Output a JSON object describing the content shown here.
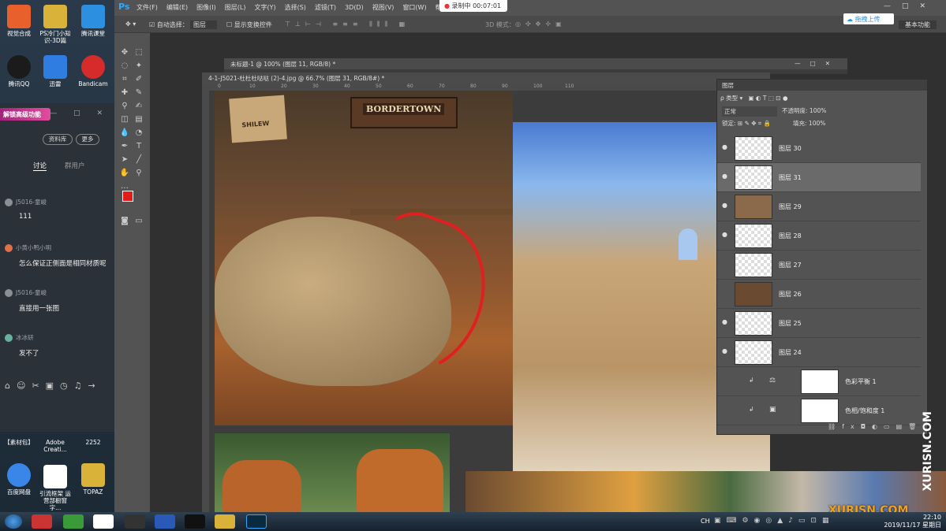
{
  "desktop": {
    "icons_top": [
      {
        "label": "视觉合成",
        "color": "#e8612c"
      },
      {
        "label": "PS冷门小知识-3D篇",
        "color": "#d9b23a"
      },
      {
        "label": "腾讯课堂",
        "color": "#2d8fe0"
      },
      {
        "label": "腾讯QQ",
        "color": "#ffffff"
      },
      {
        "label": "迅雷",
        "color": "#2f7de0"
      },
      {
        "label": "Bandicam",
        "color": "#d62b2b"
      }
    ],
    "icons_bottom": [
      {
        "label": "【素材包】",
        "color": "#555555"
      },
      {
        "label": "Adobe Creati...",
        "color": "#555555"
      },
      {
        "label": "2252",
        "color": "#555555"
      },
      {
        "label": "百度网盘",
        "color": "#3a86e8"
      },
      {
        "label": "引流框架 运营部橱窗字...",
        "color": "#ffffff"
      },
      {
        "label": "TOPAZ",
        "color": "#d9b23a"
      }
    ]
  },
  "chat": {
    "banner": "解锁高级功能",
    "pills": [
      "资料库",
      "更多"
    ],
    "tabs": [
      "讨论",
      "群用户"
    ],
    "messages": [
      {
        "name": "J5016-童峻",
        "text": "111"
      },
      {
        "name": "小黄小鸭小明",
        "text": "怎么保证正侧面是相同材质呢"
      },
      {
        "name": "J5016-童峻",
        "text": "直接用一张图"
      },
      {
        "name": "冰冰研",
        "text": "发不了"
      }
    ]
  },
  "ps": {
    "logo": "Ps",
    "menu": [
      "文件(F)",
      "编辑(E)",
      "图像(I)",
      "图层(L)",
      "文字(Y)",
      "选择(S)",
      "滤镜(T)",
      "3D(D)",
      "视图(V)",
      "窗口(W)",
      "帮助(H)"
    ],
    "recording": "录制中 00:07:01",
    "options": {
      "auto_select": "自动选择：",
      "layer_dropdown": "图层",
      "transform": "显示变换控件",
      "mode_3d": "3D 模式：",
      "cloud": "拖拽上传",
      "workspace": "基本功能"
    },
    "doc_back_title": "未标题-1 @ 100% (图层 11, RGB/8) *",
    "doc_front_title": "4-1-J5021-杜杜杜哒哒 (2)-4.jpg @ 66.7% (图层 31, RGB/8#) *",
    "canvas_text": {
      "sign": "BORDERTOWN",
      "sign2": "SHILEW",
      "ruler_labels": [
        "0",
        "10",
        "20",
        "30",
        "40",
        "50",
        "60",
        "70",
        "80",
        "90",
        "100",
        "110"
      ]
    },
    "layers_panel": {
      "title": "图层",
      "filter": "类型",
      "blend": "正常",
      "opacity_label": "不透明度:",
      "opacity": "100%",
      "lock_label": "锁定:",
      "fill_label": "填充:",
      "fill": "100%",
      "layers": [
        {
          "name": "图层 30",
          "visible": true,
          "selected": false
        },
        {
          "name": "图层 31",
          "visible": true,
          "selected": true
        },
        {
          "name": "图层 29",
          "visible": true,
          "selected": false
        },
        {
          "name": "图层 28",
          "visible": true,
          "selected": false
        },
        {
          "name": "图层 27",
          "visible": false,
          "selected": false
        },
        {
          "name": "图层 26",
          "visible": false,
          "selected": false
        },
        {
          "name": "图层 25",
          "visible": true,
          "selected": false
        },
        {
          "name": "图层 24",
          "visible": true,
          "selected": false
        },
        {
          "name": "色彩平衡 1",
          "visible": false,
          "selected": false
        },
        {
          "name": "色相/饱和度 1",
          "visible": false,
          "selected": false
        }
      ]
    }
  },
  "taskbar": {
    "time": "22:10",
    "date": "2019/11/17 星期日",
    "ime": "CH"
  },
  "watermark": {
    "vertical": "XURISN.COM",
    "logo": "XURISN.COM"
  }
}
